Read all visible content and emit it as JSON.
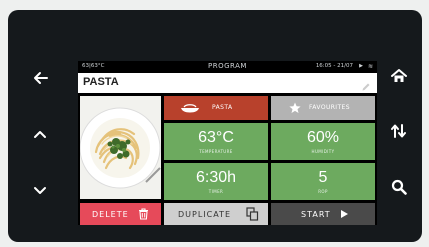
{
  "status_bar": {
    "temperature": "63|63°C",
    "title": "PROGRAM",
    "datetime": "16:05 - 21/07",
    "play_glyph": "▶",
    "wifi_glyph": "≋"
  },
  "recipe": {
    "name": "PASTA"
  },
  "category_button": {
    "label": "PASTA",
    "icon": "dish-icon",
    "color": "#b8412c"
  },
  "favourites_button": {
    "label": "FAVOURITES",
    "icon": "star-icon",
    "color": "#b3b3b3"
  },
  "parameters": {
    "temperature": {
      "value": "63°C",
      "label": "TEMPERATURE"
    },
    "humidity": {
      "value": "60%",
      "label": "HUMIDITY"
    },
    "timer": {
      "value": "6:30h",
      "label": "TIMER"
    },
    "rop": {
      "value": "5",
      "label": "ROP"
    }
  },
  "actions": {
    "delete": {
      "label": "DELETE",
      "color": "#e64a5a"
    },
    "duplicate": {
      "label": "DUPLICATE",
      "color": "#cfcfcf"
    },
    "start": {
      "label": "START",
      "color": "#4a4a4a"
    }
  },
  "side_buttons": {
    "left": [
      "back-arrow-icon",
      "chevron-up-icon",
      "chevron-down-icon"
    ],
    "right": [
      "home-icon",
      "sort-arrows-icon",
      "search-icon"
    ]
  },
  "colors": {
    "device": "#15191c",
    "tile_green": "#6daa5f"
  }
}
